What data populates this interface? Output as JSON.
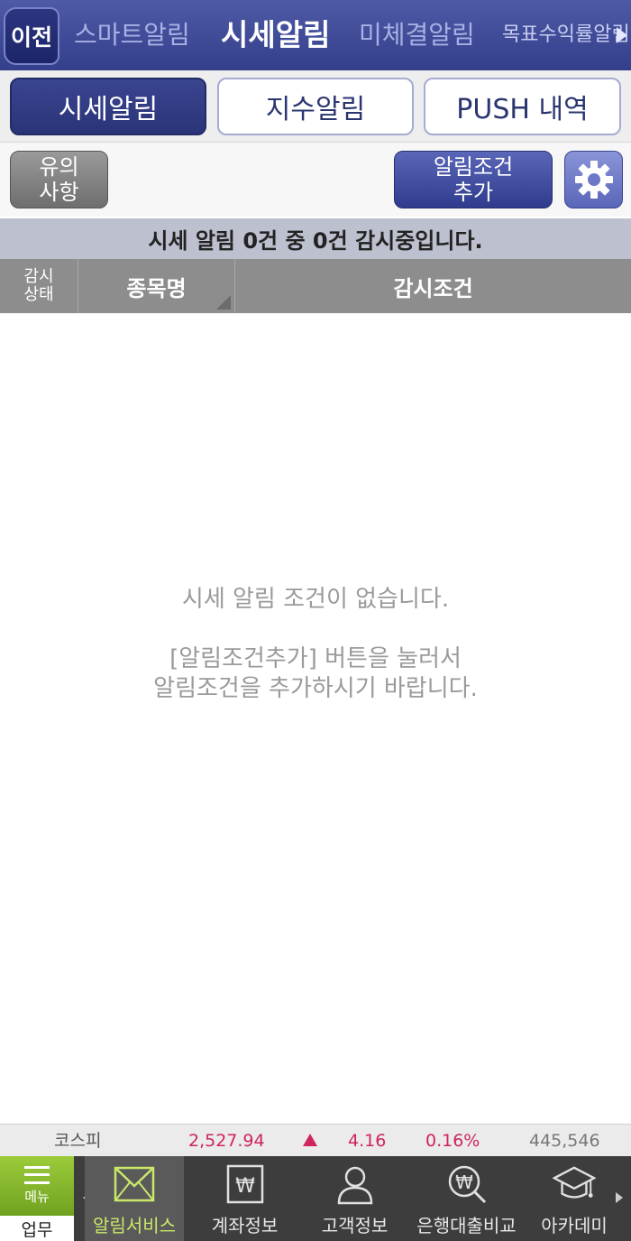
{
  "top_tabs": {
    "back_label": "이전",
    "items": [
      {
        "label": "스마트알림"
      },
      {
        "label": "시세알림"
      },
      {
        "label": "미체결알림"
      },
      {
        "label": "목표수익률알림"
      }
    ]
  },
  "sub_tabs": [
    {
      "label": "시세알림"
    },
    {
      "label": "지수알림"
    },
    {
      "label": "PUSH 내역"
    }
  ],
  "toolbar": {
    "notice_line1": "유의",
    "notice_line2": "사항",
    "add_line1": "알림조건",
    "add_line2": "추가",
    "settings_icon": "gear-icon"
  },
  "status_text": "시세 알림 0건 중 0건 감시중입니다.",
  "table": {
    "col_status_line1": "감시",
    "col_status_line2": "상태",
    "col_name": "종목명",
    "col_condition": "감시조건"
  },
  "empty_state": {
    "line1": "시세 알림 조건이 없습니다.",
    "line2": "[알림조건추가] 버튼을 눌러서",
    "line3": "알림조건을 추가하시기 바랍니다."
  },
  "ticker": {
    "name": "코스피",
    "value": "2,527.94",
    "change": "4.16",
    "percent": "0.16%",
    "volume": "445,546",
    "up_color": "#d0245c"
  },
  "bottom_nav": {
    "menu_label": "메뉴",
    "menu_section": "업무",
    "items": [
      {
        "label": "알림서비스",
        "icon": "envelope-icon"
      },
      {
        "label": "계좌정보",
        "icon": "won-document-icon"
      },
      {
        "label": "고객정보",
        "icon": "person-icon"
      },
      {
        "label": "은행대출비교",
        "icon": "won-search-icon"
      },
      {
        "label": "아카데미",
        "icon": "graduation-cap-icon"
      }
    ]
  }
}
